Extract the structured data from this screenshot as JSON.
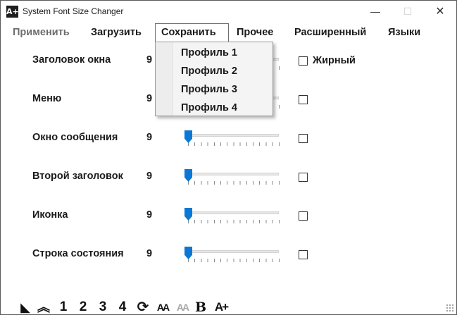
{
  "window": {
    "title": "System Font Size Changer",
    "app_icon": "A+",
    "minimize_glyph": "—",
    "maximize_glyph": "☐",
    "close_glyph": "✕"
  },
  "menu": {
    "items": [
      {
        "label": "Применить",
        "state": "disabled"
      },
      {
        "label": "Загрузить",
        "state": "normal"
      },
      {
        "label": "Сохранить",
        "state": "open"
      },
      {
        "label": "Прочее",
        "state": "normal"
      },
      {
        "label": "Расширенный",
        "state": "normal"
      },
      {
        "label": "Языки",
        "state": "normal"
      }
    ]
  },
  "dropdown": {
    "items": [
      "Профиль 1",
      "Профиль 2",
      "Профиль 3",
      "Профиль 4"
    ]
  },
  "settings": {
    "rows": [
      {
        "label": "Заголовок окна",
        "value": "9",
        "bold_checked": false
      },
      {
        "label": "Меню",
        "value": "9",
        "bold_checked": false
      },
      {
        "label": "Окно сообщения",
        "value": "9",
        "bold_checked": false
      },
      {
        "label": "Второй заголовок",
        "value": "9",
        "bold_checked": false
      },
      {
        "label": "Иконка",
        "value": "9",
        "bold_checked": false
      },
      {
        "label": "Строка состояния",
        "value": "9",
        "bold_checked": false
      }
    ],
    "bold_label": "Жирный"
  },
  "toolbar": {
    "tools": [
      {
        "icon": "contrast-icon",
        "glyph": "◣"
      },
      {
        "icon": "double-up-chevron-icon",
        "glyph": "︽"
      },
      {
        "icon": "preset-1",
        "glyph": "1"
      },
      {
        "icon": "preset-2",
        "glyph": "2"
      },
      {
        "icon": "preset-3",
        "glyph": "3"
      },
      {
        "icon": "preset-4",
        "glyph": "4"
      },
      {
        "icon": "refresh-icon",
        "glyph": "⟳"
      },
      {
        "icon": "font-small-icon",
        "glyph": "AA"
      },
      {
        "icon": "font-small-disabled-icon",
        "glyph": "AA"
      },
      {
        "icon": "bold-icon",
        "glyph": "B"
      },
      {
        "icon": "font-increase-icon",
        "glyph": "A+"
      }
    ]
  },
  "colors": {
    "accent": "#0a78d4",
    "disabled_text": "#6d6d6d"
  }
}
